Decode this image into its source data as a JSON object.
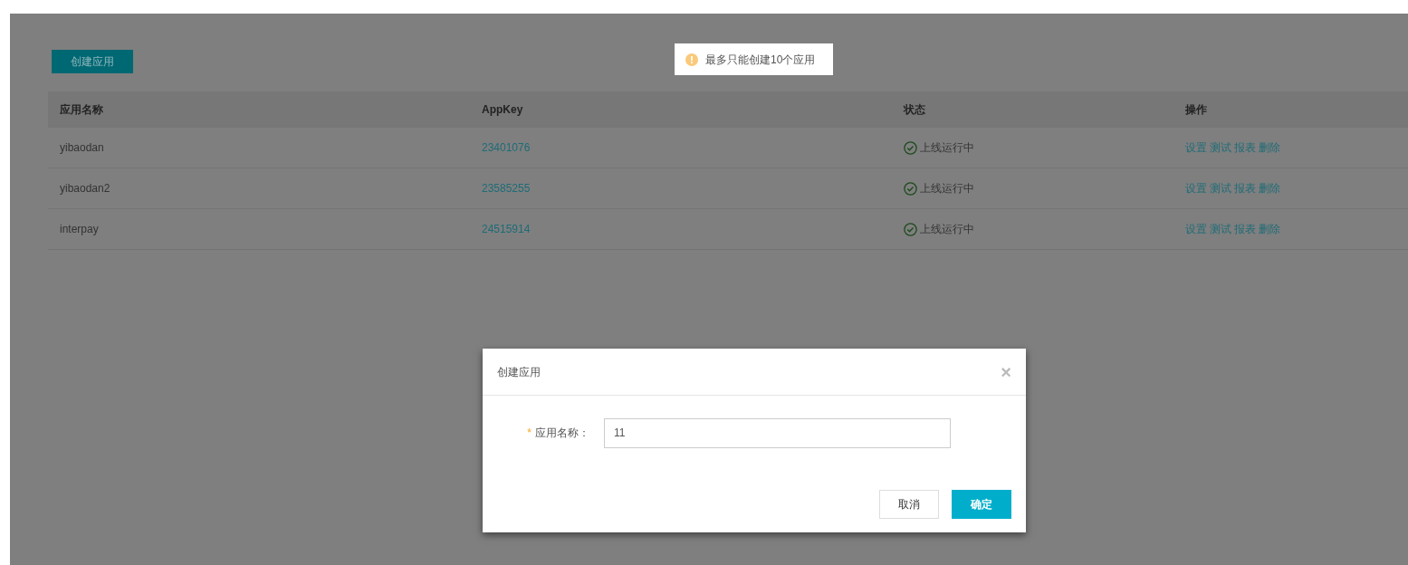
{
  "create_button": "创建应用",
  "toast": {
    "message": "最多只能创建10个应用"
  },
  "table": {
    "columns": [
      "应用名称",
      "AppKey",
      "状态",
      "操作"
    ],
    "rows": [
      {
        "name": "yibaodan",
        "appkey": "23401076",
        "status": "上线运行中",
        "actions": [
          "设置",
          "测试",
          "报表",
          "删除"
        ]
      },
      {
        "name": "yibaodan2",
        "appkey": "23585255",
        "status": "上线运行中",
        "actions": [
          "设置",
          "测试",
          "报表",
          "删除"
        ]
      },
      {
        "name": "interpay",
        "appkey": "24515914",
        "status": "上线运行中",
        "actions": [
          "设置",
          "测试",
          "报表",
          "删除"
        ]
      }
    ]
  },
  "modal": {
    "title": "创建应用",
    "close": "×",
    "field": {
      "label": "应用名称：",
      "required": true,
      "required_mark": "*",
      "value": "11"
    },
    "buttons": [
      {
        "label": "取消",
        "kind": "secondary"
      },
      {
        "label": "确定",
        "kind": "primary"
      }
    ]
  }
}
